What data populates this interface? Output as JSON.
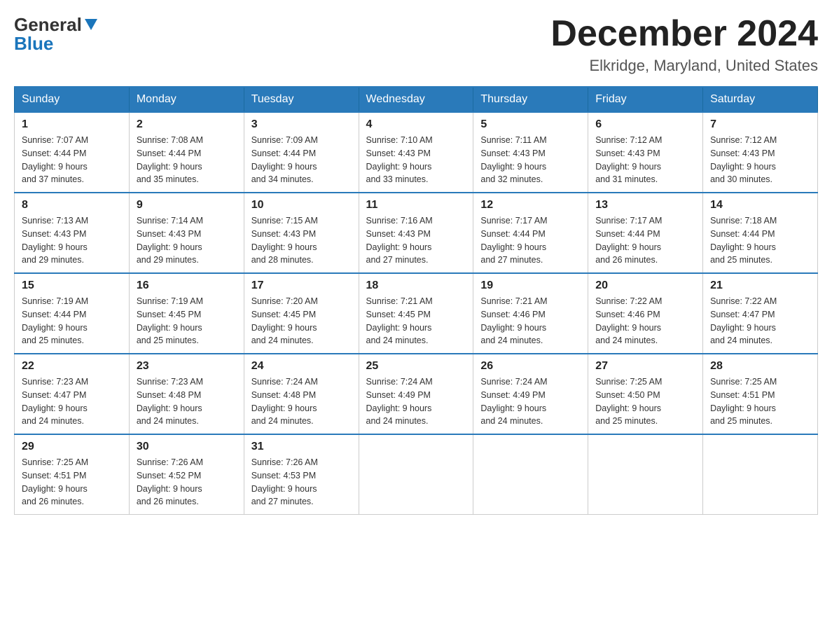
{
  "header": {
    "logo_general": "General",
    "logo_blue": "Blue",
    "month_title": "December 2024",
    "location": "Elkridge, Maryland, United States"
  },
  "weekdays": [
    "Sunday",
    "Monday",
    "Tuesday",
    "Wednesday",
    "Thursday",
    "Friday",
    "Saturday"
  ],
  "weeks": [
    [
      {
        "day": "1",
        "sunrise": "7:07 AM",
        "sunset": "4:44 PM",
        "daylight": "9 hours and 37 minutes."
      },
      {
        "day": "2",
        "sunrise": "7:08 AM",
        "sunset": "4:44 PM",
        "daylight": "9 hours and 35 minutes."
      },
      {
        "day": "3",
        "sunrise": "7:09 AM",
        "sunset": "4:44 PM",
        "daylight": "9 hours and 34 minutes."
      },
      {
        "day": "4",
        "sunrise": "7:10 AM",
        "sunset": "4:43 PM",
        "daylight": "9 hours and 33 minutes."
      },
      {
        "day": "5",
        "sunrise": "7:11 AM",
        "sunset": "4:43 PM",
        "daylight": "9 hours and 32 minutes."
      },
      {
        "day": "6",
        "sunrise": "7:12 AM",
        "sunset": "4:43 PM",
        "daylight": "9 hours and 31 minutes."
      },
      {
        "day": "7",
        "sunrise": "7:12 AM",
        "sunset": "4:43 PM",
        "daylight": "9 hours and 30 minutes."
      }
    ],
    [
      {
        "day": "8",
        "sunrise": "7:13 AM",
        "sunset": "4:43 PM",
        "daylight": "9 hours and 29 minutes."
      },
      {
        "day": "9",
        "sunrise": "7:14 AM",
        "sunset": "4:43 PM",
        "daylight": "9 hours and 29 minutes."
      },
      {
        "day": "10",
        "sunrise": "7:15 AM",
        "sunset": "4:43 PM",
        "daylight": "9 hours and 28 minutes."
      },
      {
        "day": "11",
        "sunrise": "7:16 AM",
        "sunset": "4:43 PM",
        "daylight": "9 hours and 27 minutes."
      },
      {
        "day": "12",
        "sunrise": "7:17 AM",
        "sunset": "4:44 PM",
        "daylight": "9 hours and 27 minutes."
      },
      {
        "day": "13",
        "sunrise": "7:17 AM",
        "sunset": "4:44 PM",
        "daylight": "9 hours and 26 minutes."
      },
      {
        "day": "14",
        "sunrise": "7:18 AM",
        "sunset": "4:44 PM",
        "daylight": "9 hours and 25 minutes."
      }
    ],
    [
      {
        "day": "15",
        "sunrise": "7:19 AM",
        "sunset": "4:44 PM",
        "daylight": "9 hours and 25 minutes."
      },
      {
        "day": "16",
        "sunrise": "7:19 AM",
        "sunset": "4:45 PM",
        "daylight": "9 hours and 25 minutes."
      },
      {
        "day": "17",
        "sunrise": "7:20 AM",
        "sunset": "4:45 PM",
        "daylight": "9 hours and 24 minutes."
      },
      {
        "day": "18",
        "sunrise": "7:21 AM",
        "sunset": "4:45 PM",
        "daylight": "9 hours and 24 minutes."
      },
      {
        "day": "19",
        "sunrise": "7:21 AM",
        "sunset": "4:46 PM",
        "daylight": "9 hours and 24 minutes."
      },
      {
        "day": "20",
        "sunrise": "7:22 AM",
        "sunset": "4:46 PM",
        "daylight": "9 hours and 24 minutes."
      },
      {
        "day": "21",
        "sunrise": "7:22 AM",
        "sunset": "4:47 PM",
        "daylight": "9 hours and 24 minutes."
      }
    ],
    [
      {
        "day": "22",
        "sunrise": "7:23 AM",
        "sunset": "4:47 PM",
        "daylight": "9 hours and 24 minutes."
      },
      {
        "day": "23",
        "sunrise": "7:23 AM",
        "sunset": "4:48 PM",
        "daylight": "9 hours and 24 minutes."
      },
      {
        "day": "24",
        "sunrise": "7:24 AM",
        "sunset": "4:48 PM",
        "daylight": "9 hours and 24 minutes."
      },
      {
        "day": "25",
        "sunrise": "7:24 AM",
        "sunset": "4:49 PM",
        "daylight": "9 hours and 24 minutes."
      },
      {
        "day": "26",
        "sunrise": "7:24 AM",
        "sunset": "4:49 PM",
        "daylight": "9 hours and 24 minutes."
      },
      {
        "day": "27",
        "sunrise": "7:25 AM",
        "sunset": "4:50 PM",
        "daylight": "9 hours and 25 minutes."
      },
      {
        "day": "28",
        "sunrise": "7:25 AM",
        "sunset": "4:51 PM",
        "daylight": "9 hours and 25 minutes."
      }
    ],
    [
      {
        "day": "29",
        "sunrise": "7:25 AM",
        "sunset": "4:51 PM",
        "daylight": "9 hours and 26 minutes."
      },
      {
        "day": "30",
        "sunrise": "7:26 AM",
        "sunset": "4:52 PM",
        "daylight": "9 hours and 26 minutes."
      },
      {
        "day": "31",
        "sunrise": "7:26 AM",
        "sunset": "4:53 PM",
        "daylight": "9 hours and 27 minutes."
      },
      null,
      null,
      null,
      null
    ]
  ],
  "labels": {
    "sunrise": "Sunrise:",
    "sunset": "Sunset:",
    "daylight": "Daylight:"
  }
}
